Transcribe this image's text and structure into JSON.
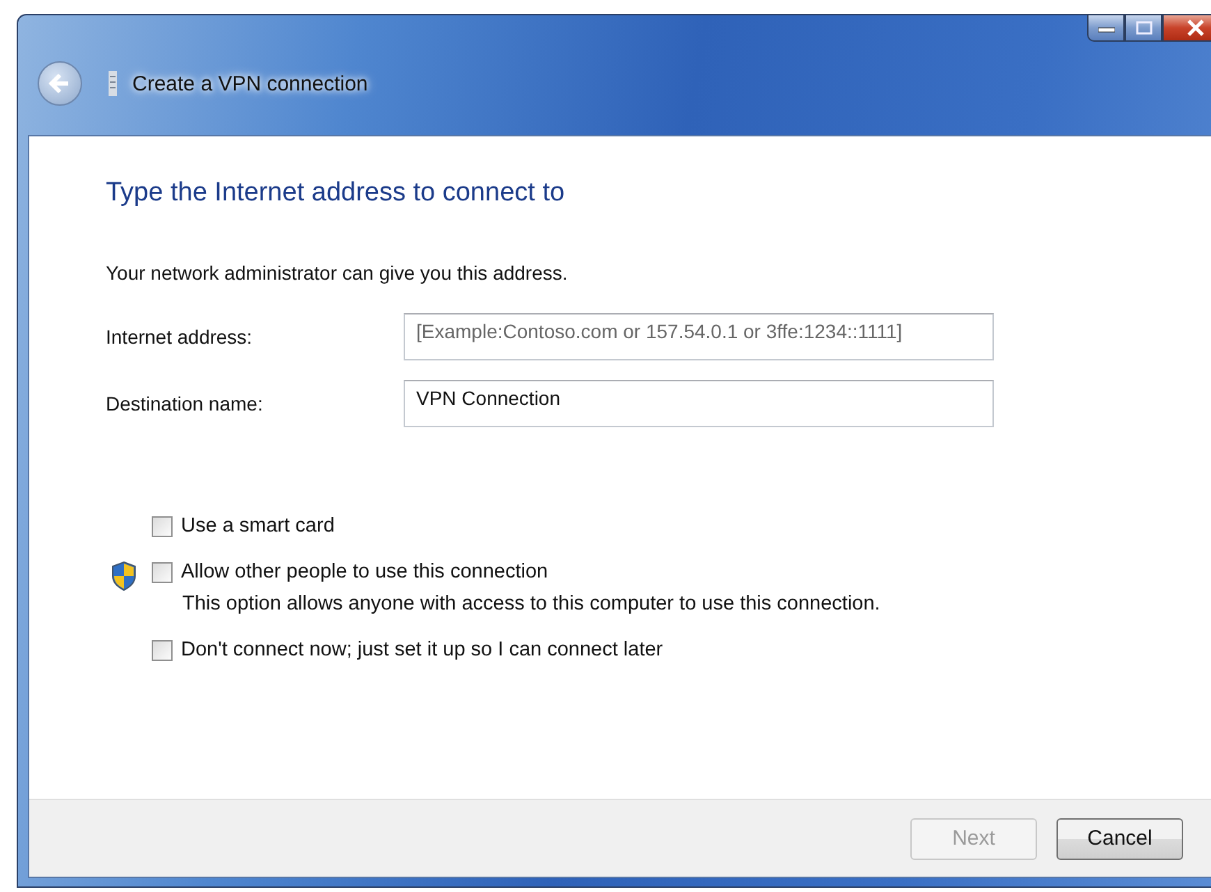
{
  "window": {
    "title": "Create a VPN connection"
  },
  "heading": "Type the Internet address to connect to",
  "intro": "Your network administrator can give you this address.",
  "fields": [
    {
      "label": "Internet address:",
      "placeholder": "[Example:Contoso.com or 157.54.0.1 or 3ffe:1234::1111]"
    },
    {
      "label": "Destination name:",
      "value": "VPN Connection"
    }
  ],
  "options": [
    {
      "label": "Use a smart card",
      "checked": false,
      "shield": false
    },
    {
      "label": "Allow other people to use this connection",
      "checked": false,
      "shield": true,
      "description": "This option allows anyone with access to this computer to use this connection."
    },
    {
      "label": "Don't connect now; just set it up so I can connect later",
      "checked": false,
      "shield": false
    }
  ],
  "buttons": [
    {
      "label": "Next",
      "disabled": true
    },
    {
      "label": "Cancel",
      "disabled": false
    }
  ]
}
